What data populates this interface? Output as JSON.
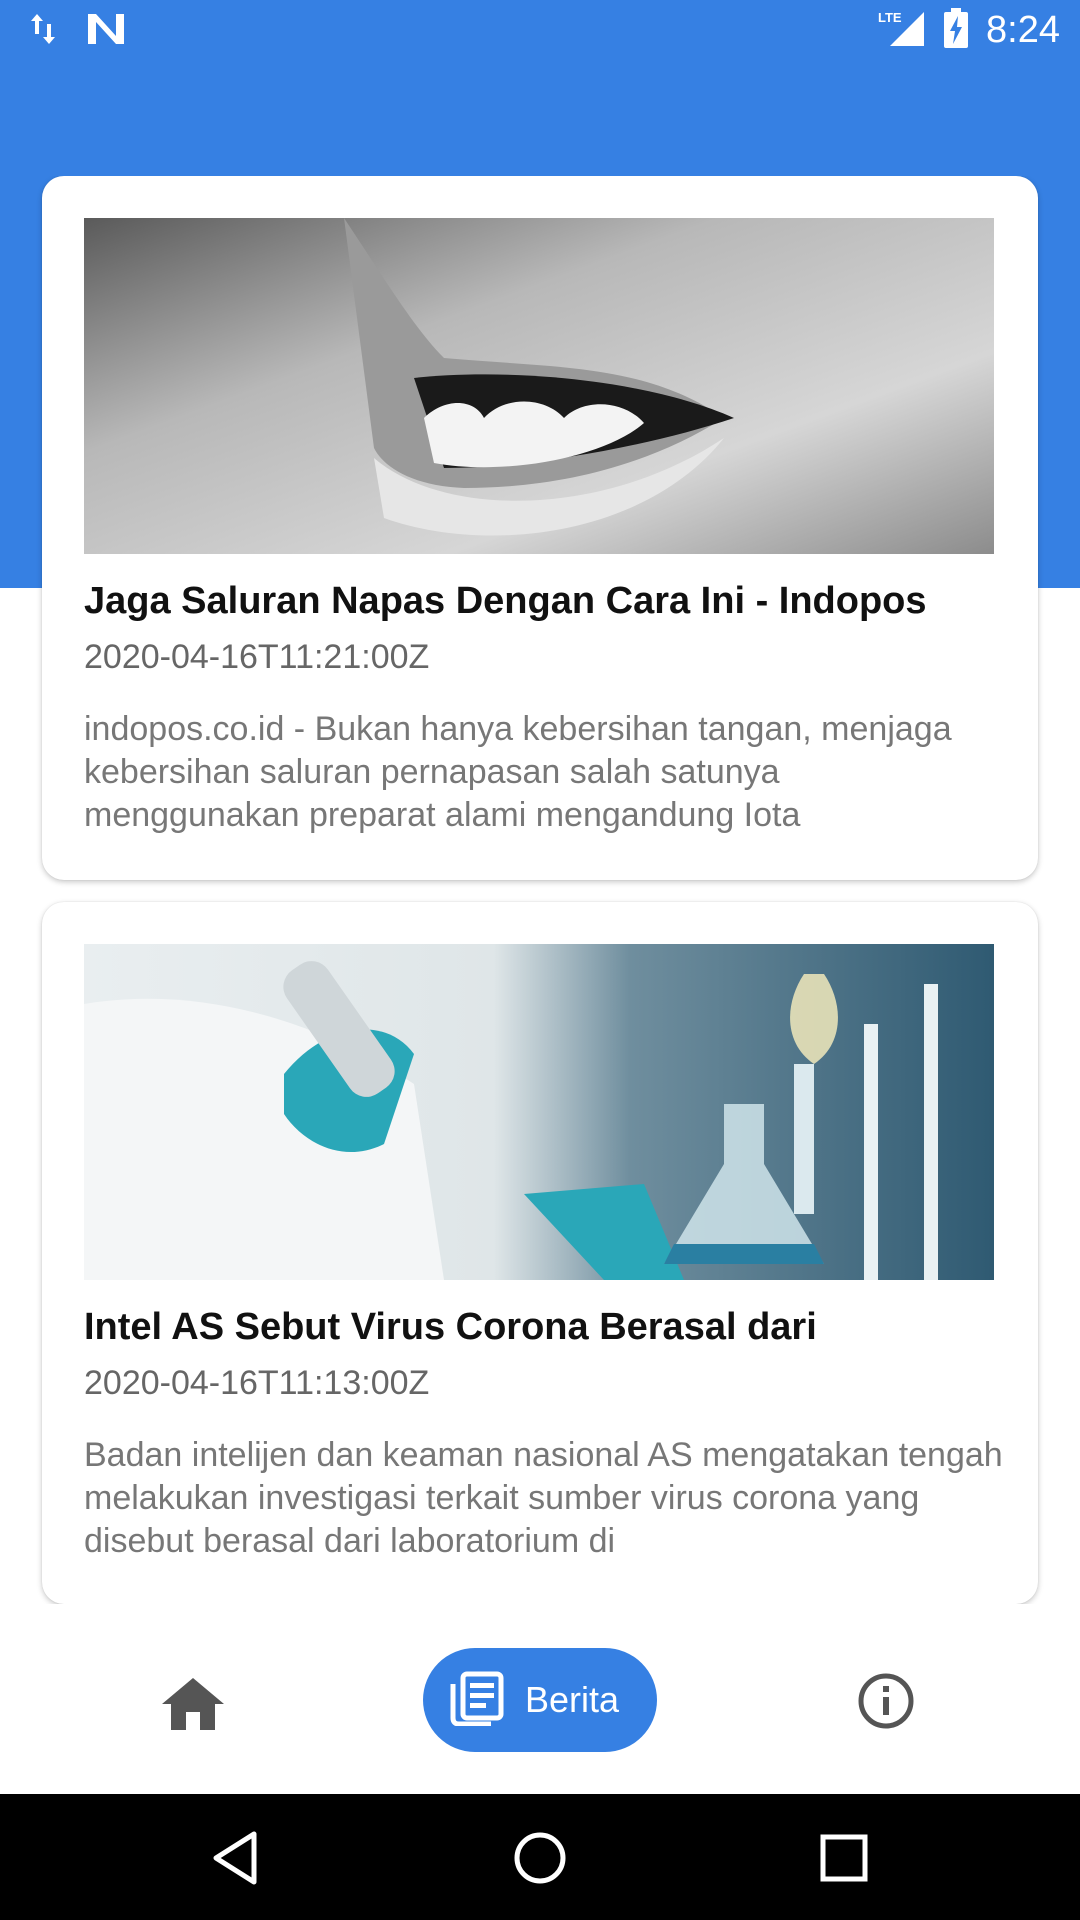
{
  "status_bar": {
    "time": "8:24",
    "network": "LTE",
    "icons": [
      "data-transfer-icon",
      "n-logo-icon",
      "lte-signal-icon",
      "battery-charging-icon"
    ]
  },
  "articles": [
    {
      "title": "Jaga Saluran Napas Dengan Cara Ini - Indopos",
      "date": "2020-04-16T11:21:00Z",
      "description": "indopos.co.id - Bukan hanya kebersihan tangan, menjaga kebersihan saluran pernapasan salah satunya menggunakan preparat alami mengandung Iota",
      "image_icon": "smile-photo"
    },
    {
      "title": "Intel AS Sebut Virus Corona Berasal dari",
      "date": "2020-04-16T11:13:00Z",
      "description": "Badan intelijen dan keaman nasional AS mengatakan tengah melakukan investigasi terkait sumber virus corona yang disebut berasal dari laboratorium di",
      "image_icon": "laboratory-photo"
    }
  ],
  "bottom_nav": {
    "home_icon": "home-icon",
    "active_label": "Berita",
    "active_icon": "news-icon",
    "info_icon": "info-icon"
  },
  "colors": {
    "primary": "#3680e3",
    "title_text": "#111111",
    "meta_text": "#666666"
  },
  "system_nav": [
    "back-icon",
    "home-circle-icon",
    "recents-icon"
  ]
}
